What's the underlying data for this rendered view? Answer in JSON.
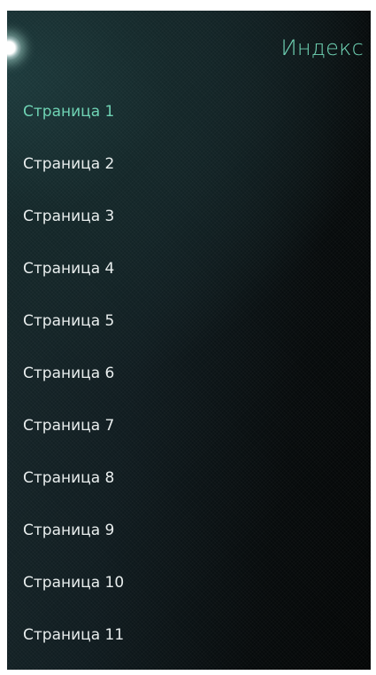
{
  "header": {
    "title": "Индекс"
  },
  "pages": [
    {
      "label": "Страница 1",
      "active": true
    },
    {
      "label": "Страница 2",
      "active": false
    },
    {
      "label": "Страница 3",
      "active": false
    },
    {
      "label": "Страница 4",
      "active": false
    },
    {
      "label": "Страница 5",
      "active": false
    },
    {
      "label": "Страница 6",
      "active": false
    },
    {
      "label": "Страница 7",
      "active": false
    },
    {
      "label": "Страница 8",
      "active": false
    },
    {
      "label": "Страница 9",
      "active": false
    },
    {
      "label": "Страница 10",
      "active": false
    },
    {
      "label": "Страница 11",
      "active": false
    }
  ],
  "colors": {
    "accent": "#6fd3b4",
    "text": "#e9eeee",
    "background": "#101c20"
  }
}
